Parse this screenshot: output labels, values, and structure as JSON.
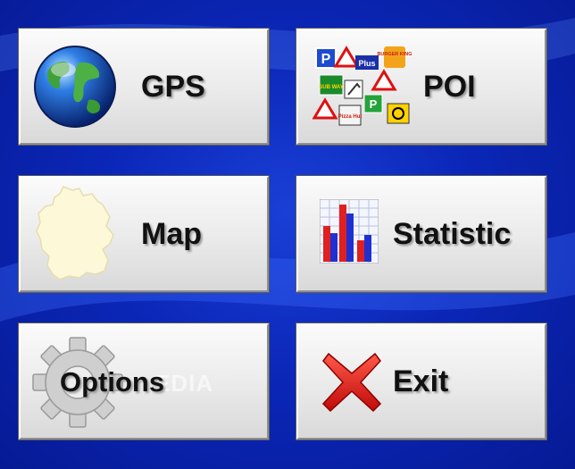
{
  "menu": {
    "gps_label": "GPS",
    "poi_label": "POI",
    "map_label": "Map",
    "statistic_label": "Statistic",
    "options_label": "Options",
    "exit_label": "Exit"
  },
  "poi_signs": {
    "parking": "P",
    "plus": "Plus",
    "burger_king": "BURGER KING",
    "subway": "SUB WAY",
    "pizza_hut": "Pizza Hut"
  },
  "watermark": "EDIA",
  "icons": {
    "gps": "globe-icon",
    "poi": "poi-signs-icon",
    "map": "germany-map-icon",
    "statistic": "bar-chart-icon",
    "options": "gear-icon",
    "exit": "red-x-icon"
  },
  "colors": {
    "background": "#0b27b8",
    "tile": "#e6e6e6",
    "label": "#111111",
    "exit_x": "#e01010",
    "bar_red": "#e02020",
    "bar_blue": "#2030d0"
  }
}
